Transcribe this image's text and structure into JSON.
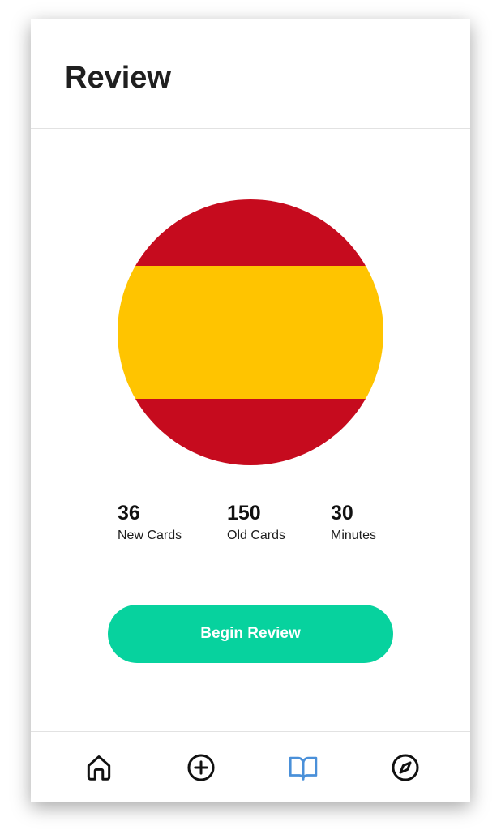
{
  "header": {
    "title": "Review"
  },
  "flag": {
    "name": "spain-flag",
    "colors": {
      "red": "#c60b1e",
      "yellow": "#ffc400"
    }
  },
  "stats": {
    "new_cards": {
      "value": "36",
      "label": "New Cards"
    },
    "old_cards": {
      "value": "150",
      "label": "Old Cards"
    },
    "minutes": {
      "value": "30",
      "label": "Minutes"
    }
  },
  "actions": {
    "begin_label": "Begin Review",
    "begin_color": "#07d29e"
  },
  "tabbar": {
    "active_color": "#4a90d9",
    "inactive_color": "#111111",
    "items": [
      {
        "icon": "home-icon",
        "active": false
      },
      {
        "icon": "plus-circle-icon",
        "active": false
      },
      {
        "icon": "open-book-icon",
        "active": true
      },
      {
        "icon": "compass-icon",
        "active": false
      }
    ]
  }
}
